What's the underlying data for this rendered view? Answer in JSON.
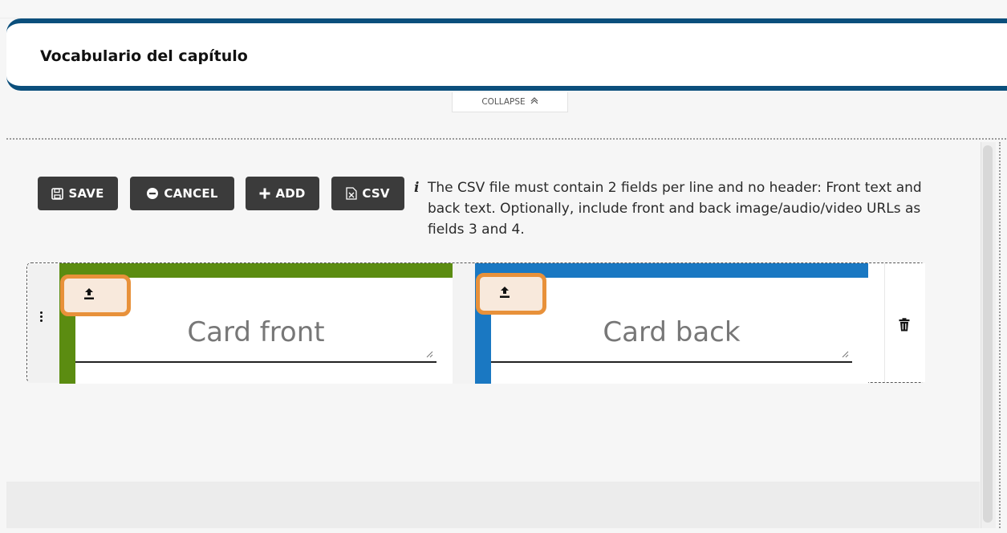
{
  "header": {
    "title": "Vocabulario del capítulo",
    "collapse_label": "COLLAPSE"
  },
  "toolbar": {
    "save_label": "SAVE",
    "cancel_label": "CANCEL",
    "add_label": "ADD",
    "csv_label": "CSV",
    "info_text": "The CSV file must contain 2 fields per line and no header: Front text and back text. Optionally, include front and back image/audio/video URLs as fields 3 and 4."
  },
  "cards": [
    {
      "front": {
        "placeholder": "Card front",
        "color": "#5b8c11"
      },
      "back": {
        "placeholder": "Card back",
        "color": "#1a78c2"
      }
    }
  ],
  "colors": {
    "header_border": "#0b4f7c",
    "button_bg": "#3b3b3b",
    "upload_highlight": "#e8913a"
  },
  "icons": [
    "save-icon",
    "minus-circle-icon",
    "plus-icon",
    "csv-file-icon",
    "info-icon",
    "upload-icon",
    "drag-handle-icon",
    "trash-icon",
    "chevron-up-icon"
  ]
}
